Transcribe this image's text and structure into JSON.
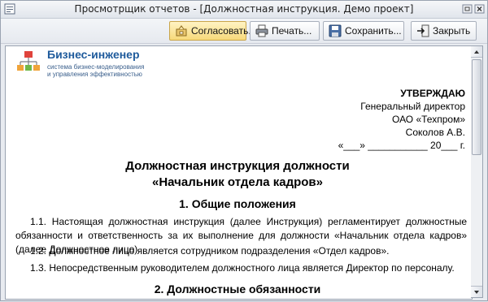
{
  "window": {
    "title": "Просмотрщик отчетов  -  [Должностная инструкция. Демо проект]"
  },
  "toolbar": {
    "approve_label": "Согласовать...",
    "print_label": "Печать...",
    "save_label": "Сохранить...",
    "close_label": "Закрыть"
  },
  "document": {
    "brand_name": "Бизнес-инженер",
    "tagline_line1": "система бизнес-моделирования",
    "tagline_line2": "и управления эффективностью",
    "approve_head": "УТВЕРЖДАЮ",
    "approve_position": "Генеральный директор",
    "approve_company": "ОАО «Техпром»",
    "approve_name": "Соколов А.В.",
    "approve_date": "«___» ___________ 20___ г.",
    "title_line1": "Должностная инструкция должности",
    "title_line2": "«Начальник отдела кадров»",
    "section1_title": "1. Общие положения",
    "para_1_1": "1.1. Настоящая должностная инструкция (далее Инструкция) регламентирует должностные обязанности и ответственность за их выполнение для должности «Начальник отдела кадров» (далее Должностное лицо).",
    "para_1_2": "1.2. Должностное лицо является сотрудником подразделения «Отдел кадров».",
    "para_1_3": "1.3. Непосредственным руководителем должностного лица является Директор по персоналу.",
    "section2_title": "2. Должностные обязанности"
  },
  "colors": {
    "brand": "#1f5b9c",
    "active_button": "#f7d97a"
  }
}
